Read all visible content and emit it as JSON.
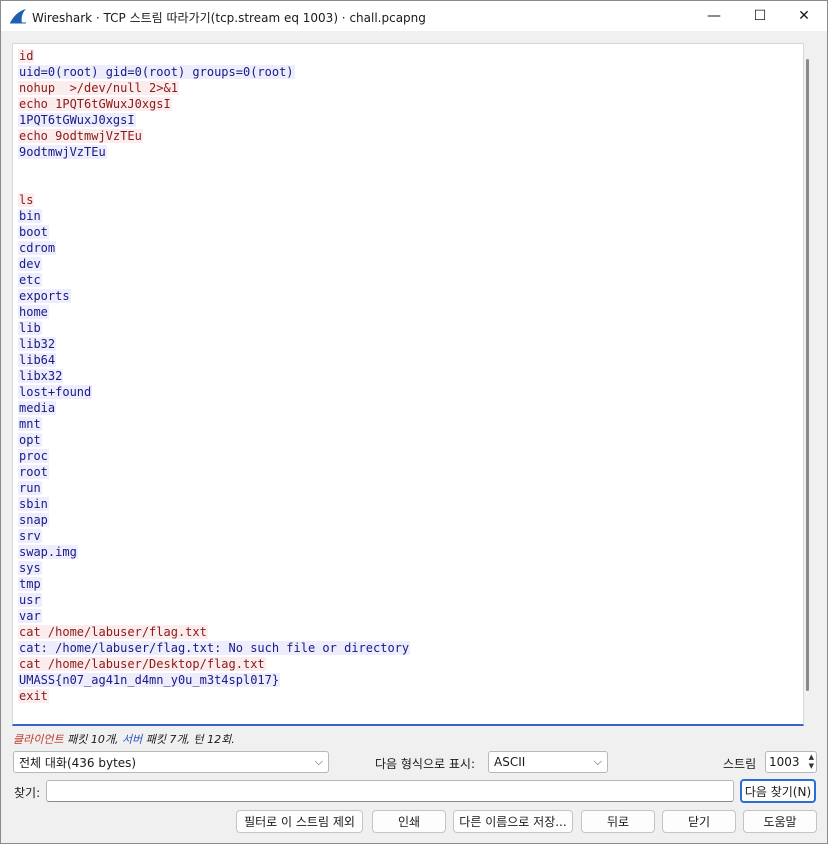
{
  "window": {
    "title": "Wireshark · TCP 스트림 따라가기(tcp.stream eq 1003) · chall.pcapng",
    "minimize": "—",
    "maximize": "☐",
    "close": "✕"
  },
  "stream": {
    "lines": [
      {
        "dir": "client",
        "text": "id"
      },
      {
        "dir": "server",
        "text": "uid=0(root) gid=0(root) groups=0(root)"
      },
      {
        "dir": "client",
        "text": "nohup  >/dev/null 2>&1"
      },
      {
        "dir": "client",
        "text": "echo 1PQT6tGWuxJ0xgsI"
      },
      {
        "dir": "server",
        "text": "1PQT6tGWuxJ0xgsI"
      },
      {
        "dir": "client",
        "text": "echo 9odtmwjVzTEu"
      },
      {
        "dir": "server",
        "text": "9odtmwjVzTEu"
      },
      {
        "dir": "none",
        "text": ""
      },
      {
        "dir": "none",
        "text": ""
      },
      {
        "dir": "client",
        "text": "ls"
      },
      {
        "dir": "server",
        "text": "bin"
      },
      {
        "dir": "server",
        "text": "boot"
      },
      {
        "dir": "server",
        "text": "cdrom"
      },
      {
        "dir": "server",
        "text": "dev"
      },
      {
        "dir": "server",
        "text": "etc"
      },
      {
        "dir": "server",
        "text": "exports"
      },
      {
        "dir": "server",
        "text": "home"
      },
      {
        "dir": "server",
        "text": "lib"
      },
      {
        "dir": "server",
        "text": "lib32"
      },
      {
        "dir": "server",
        "text": "lib64"
      },
      {
        "dir": "server",
        "text": "libx32"
      },
      {
        "dir": "server",
        "text": "lost+found"
      },
      {
        "dir": "server",
        "text": "media"
      },
      {
        "dir": "server",
        "text": "mnt"
      },
      {
        "dir": "server",
        "text": "opt"
      },
      {
        "dir": "server",
        "text": "proc"
      },
      {
        "dir": "server",
        "text": "root"
      },
      {
        "dir": "server",
        "text": "run"
      },
      {
        "dir": "server",
        "text": "sbin"
      },
      {
        "dir": "server",
        "text": "snap"
      },
      {
        "dir": "server",
        "text": "srv"
      },
      {
        "dir": "server",
        "text": "swap.img"
      },
      {
        "dir": "server",
        "text": "sys"
      },
      {
        "dir": "server",
        "text": "tmp"
      },
      {
        "dir": "server",
        "text": "usr"
      },
      {
        "dir": "server",
        "text": "var"
      },
      {
        "dir": "client",
        "text": "cat /home/labuser/flag.txt"
      },
      {
        "dir": "server",
        "text": "cat: /home/labuser/flag.txt: No such file or directory"
      },
      {
        "dir": "client",
        "text": "cat /home/labuser/Desktop/flag.txt"
      },
      {
        "dir": "server",
        "text": "UMASS{n07_ag41n_d4mn_y0u_m3t4spl017}"
      },
      {
        "dir": "client",
        "text": "exit"
      }
    ]
  },
  "summary": {
    "client": "클라이언트",
    "client_rest": " 패킷 10개, ",
    "server": "서버",
    "server_rest": " 패킷 7개, 턴 12회."
  },
  "controls": {
    "conversation_value": "전체 대화(436 bytes)",
    "format_label": "다음 형식으로 표시:",
    "format_value": "ASCII",
    "stream_label": "스트림",
    "stream_value": "1003",
    "find_label": "찾기:",
    "find_value": "",
    "find_next": "다음 찾기(N)"
  },
  "buttons": {
    "filter_out": "필터로 이 스트림 제외",
    "print": "인쇄",
    "save_as": "다른 이름으로 저장...",
    "back": "뒤로",
    "close": "닫기",
    "help": "도움말"
  },
  "colors": {
    "client_text": "#8b1a1a",
    "client_bg": "#fbeded",
    "server_text": "#1a1a8b",
    "server_bg": "#ededfb",
    "accent": "#2a6ed4"
  }
}
